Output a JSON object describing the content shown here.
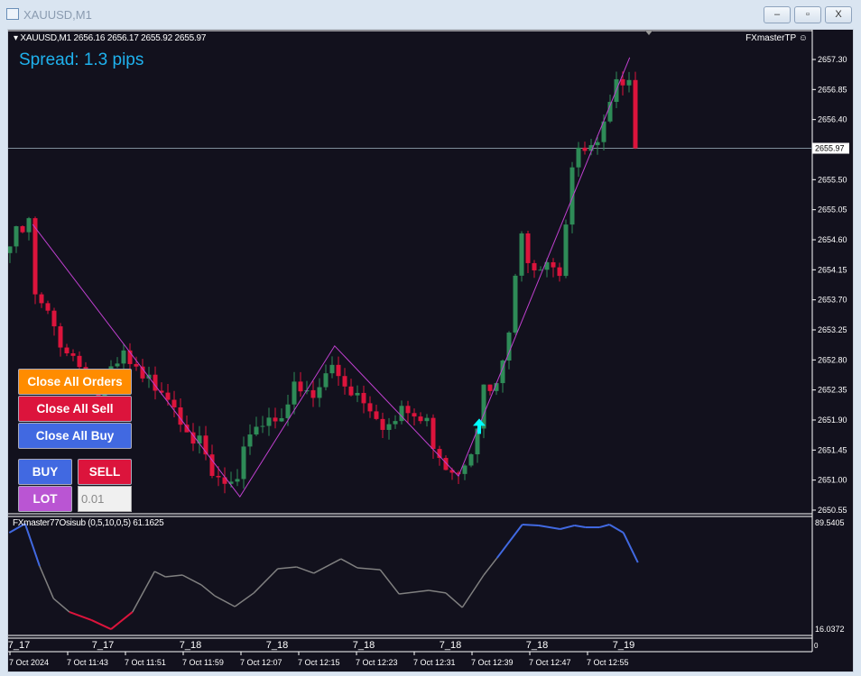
{
  "window": {
    "title": "XAUUSD,M1",
    "buttons": {
      "minimize": "–",
      "restore": "▫",
      "close": "X"
    }
  },
  "header": {
    "symbol_line": "XAUUSD,M1  2656.16 2656.17 2655.92 2655.97",
    "expert": "FXmasterTP",
    "spread": "Spread: 1.3 pips"
  },
  "panel": {
    "close_all_orders": "Close All Orders",
    "close_all_sell": "Close All Sell",
    "close_all_buy": "Close All Buy",
    "buy": "BUY",
    "sell": "SELL",
    "lot_label": "LOT",
    "lot_value": "0.01",
    "colors": {
      "orders": "#ff8c00",
      "sell": "#dc143c",
      "buy": "#4169e1",
      "lot": "#ba55d3"
    }
  },
  "chart_data": {
    "type": "candlestick",
    "symbol": "XAUUSD",
    "timeframe": "M1",
    "price_ticks": [
      "2657.30",
      "2656.85",
      "2656.40",
      "2655.50",
      "2655.05",
      "2654.60",
      "2654.15",
      "2653.70",
      "2653.25",
      "2652.80",
      "2652.35",
      "2651.90",
      "2651.45",
      "2651.00",
      "2650.55"
    ],
    "current_price": "2655.97",
    "ylim": [
      2650.55,
      2657.3
    ],
    "candles": 100,
    "close_waypoints": [
      [
        0,
        2654.5
      ],
      [
        3,
        2654.8
      ],
      [
        4,
        2653.7
      ],
      [
        6,
        2653.4
      ],
      [
        9,
        2653.0
      ],
      [
        12,
        2652.6
      ],
      [
        14,
        2652.2
      ],
      [
        18,
        2652.8
      ],
      [
        21,
        2652.4
      ],
      [
        24,
        2652.5
      ],
      [
        28,
        2651.9
      ],
      [
        32,
        2651.0
      ],
      [
        36,
        2650.8
      ],
      [
        38,
        2651.8
      ],
      [
        42,
        2652.0
      ],
      [
        45,
        2652.3
      ],
      [
        48,
        2652.2
      ],
      [
        51,
        2652.7
      ],
      [
        54,
        2652.4
      ],
      [
        57,
        2652.2
      ],
      [
        60,
        2651.8
      ],
      [
        63,
        2652.0
      ],
      [
        66,
        2651.8
      ],
      [
        69,
        2651.3
      ],
      [
        71,
        2651.2
      ],
      [
        73,
        2651.6
      ],
      [
        75,
        2652.3
      ],
      [
        77,
        2652.3
      ],
      [
        79,
        2653.2
      ],
      [
        81,
        2654.6
      ],
      [
        83,
        2654.3
      ],
      [
        85,
        2654.4
      ],
      [
        87,
        2654.2
      ],
      [
        89,
        2655.7
      ],
      [
        91,
        2655.9
      ],
      [
        93,
        2655.9
      ],
      [
        95,
        2656.5
      ],
      [
        97,
        2657.1
      ],
      [
        98,
        2657.2
      ],
      [
        99,
        2655.97
      ]
    ],
    "zigzag": [
      [
        3.6,
        2654.83
      ],
      [
        36.4,
        2650.75
      ],
      [
        51.4,
        2653.01
      ],
      [
        71,
        2651.06
      ],
      [
        98.1,
        2657.33
      ]
    ],
    "buy_arrow": {
      "index": 74,
      "price": 2651.8
    },
    "colors": {
      "bull": "#2e8b57",
      "bear": "#dc143c",
      "zigzag": "#c040d0",
      "arrow": "#00ffff"
    },
    "oscillator": {
      "label": "FXmaster77Osisub (0,5,10,0,5) 61.1625",
      "max_label": "89.5405",
      "min_label": "16.0372",
      "ylim": [
        16.0372,
        89.5405
      ],
      "points": [
        [
          -0.1,
          82.7
        ],
        [
          2.4,
          88.9
        ],
        [
          4.7,
          59.6
        ],
        [
          6.9,
          37.2
        ],
        [
          9.4,
          27.9
        ],
        [
          12.9,
          22.3
        ],
        [
          16,
          16.0
        ],
        [
          19.4,
          27.9
        ],
        [
          22.9,
          55.9
        ],
        [
          24.6,
          52.2
        ],
        [
          27.3,
          53.4
        ],
        [
          30.3,
          46.6
        ],
        [
          32.4,
          39.1
        ],
        [
          35.6,
          31.6
        ],
        [
          38.6,
          41.0
        ],
        [
          42.4,
          57.8
        ],
        [
          45.4,
          59.0
        ],
        [
          48.1,
          54.7
        ],
        [
          52.4,
          64.6
        ],
        [
          55,
          58.4
        ],
        [
          58.6,
          57.1
        ],
        [
          61.6,
          40.3
        ],
        [
          66.3,
          42.8
        ],
        [
          69,
          41.0
        ],
        [
          71.6,
          31.0
        ],
        [
          75,
          53.4
        ],
        [
          77.1,
          65.2
        ],
        [
          81.1,
          88.3
        ],
        [
          83.7,
          87.7
        ],
        [
          87.1,
          85.2
        ],
        [
          89.4,
          87.7
        ],
        [
          91.1,
          86.4
        ],
        [
          93.3,
          86.4
        ],
        [
          94.9,
          88.3
        ],
        [
          97.1,
          82.7
        ],
        [
          99.4,
          62.1
        ]
      ],
      "colors": {
        "high": "#4169e1",
        "low": "#dc143c",
        "mid": "#808080"
      }
    },
    "day_labels": [
      "7_17",
      "7_17",
      "7_18",
      "7_18",
      "7_18",
      "7_18",
      "7_18",
      "7_19"
    ],
    "time_labels": [
      "7 Oct 2024",
      "7 Oct 11:43",
      "7 Oct 11:51",
      "7 Oct 11:59",
      "7 Oct 12:07",
      "7 Oct 12:15",
      "7 Oct 12:23",
      "7 Oct 12:31",
      "7 Oct 12:39",
      "7 Oct 12:47",
      "7 Oct 12:55"
    ]
  }
}
